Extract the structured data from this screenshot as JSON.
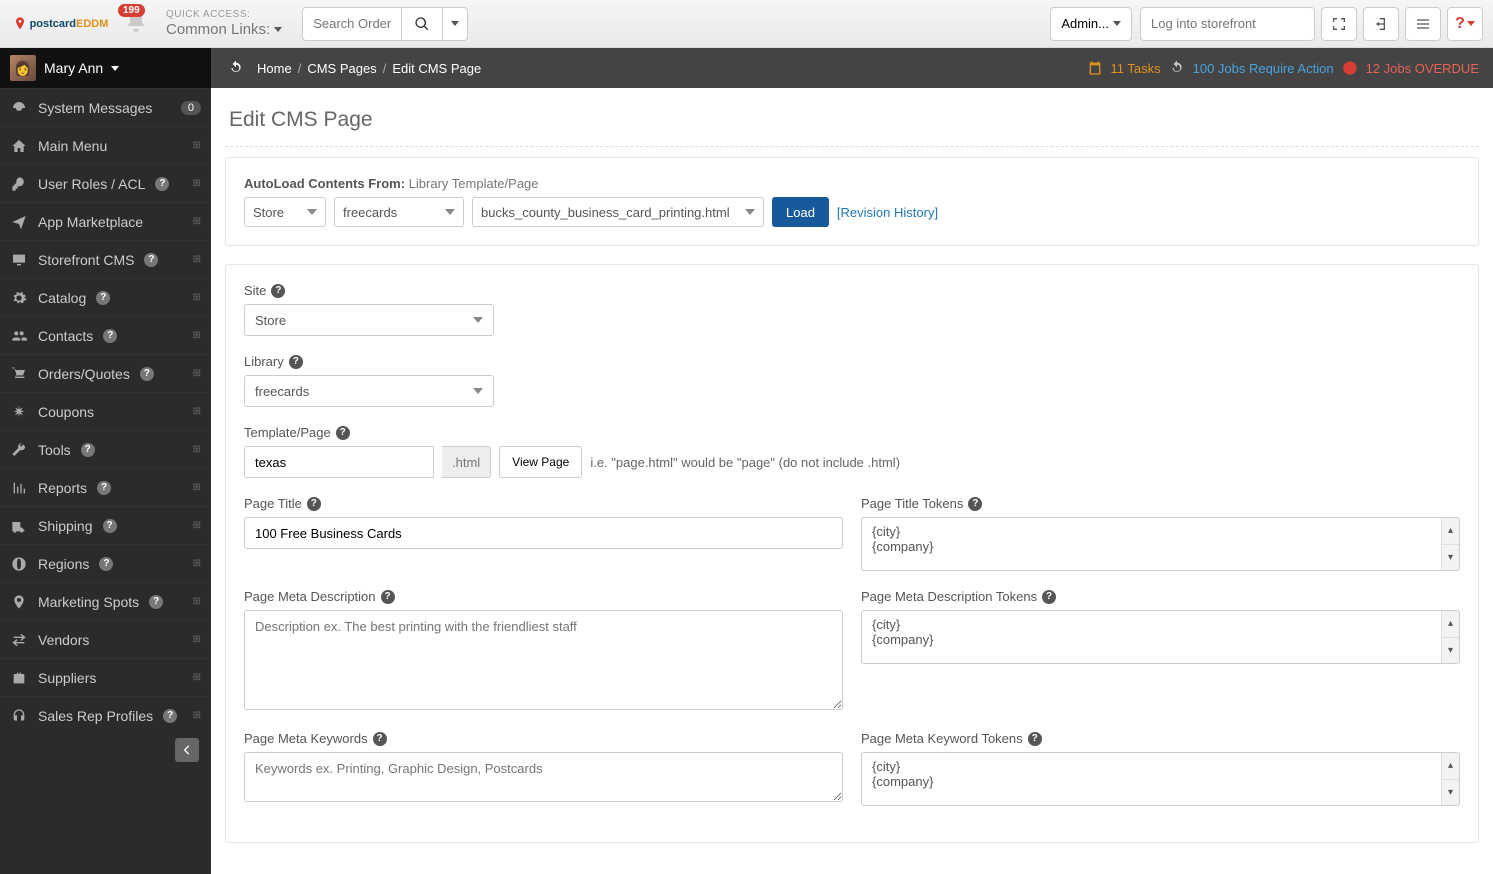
{
  "topbar": {
    "logo_pc": "postcard",
    "logo_eddm": "EDDM",
    "notif_count": "199",
    "quick_access_label": "QUICK ACCESS:",
    "quick_access_value": "Common Links:",
    "search_placeholder": "Search Orders/J",
    "admin_label": "Admin...",
    "storefront_placeholder": "Log into storefront"
  },
  "user": {
    "name": "Mary Ann"
  },
  "sidebar": {
    "items": [
      {
        "label": "System Messages",
        "badge": "0",
        "icon": "tachometer"
      },
      {
        "label": "Main Menu",
        "icon": "home",
        "expand": true
      },
      {
        "label": "User Roles / ACL",
        "icon": "key",
        "help": true,
        "expand": true
      },
      {
        "label": "App Marketplace",
        "icon": "plane",
        "expand": true
      },
      {
        "label": "Storefront CMS",
        "icon": "monitor",
        "help": true,
        "expand": true
      },
      {
        "label": "Catalog",
        "icon": "gears",
        "help": true,
        "expand": true
      },
      {
        "label": "Contacts",
        "icon": "users",
        "help": true,
        "expand": true
      },
      {
        "label": "Orders/Quotes",
        "icon": "cart",
        "help": true,
        "expand": true
      },
      {
        "label": "Coupons",
        "icon": "asterisk",
        "expand": true
      },
      {
        "label": "Tools",
        "icon": "wrench",
        "help": true,
        "expand": true
      },
      {
        "label": "Reports",
        "icon": "chart",
        "help": true,
        "expand": true
      },
      {
        "label": "Shipping",
        "icon": "truck",
        "help": true,
        "expand": true
      },
      {
        "label": "Regions",
        "icon": "globe",
        "help": true,
        "expand": true
      },
      {
        "label": "Marketing Spots",
        "icon": "pin",
        "help": true,
        "expand": true
      },
      {
        "label": "Vendors",
        "icon": "exchange",
        "expand": true
      },
      {
        "label": "Suppliers",
        "icon": "briefcase",
        "expand": true
      },
      {
        "label": "Sales Rep Profiles",
        "icon": "headphones",
        "help": true,
        "expand": true
      }
    ]
  },
  "breadcrumb": {
    "home": "Home",
    "cms": "CMS Pages",
    "current": "Edit CMS Page",
    "tasks": "11 Tasks",
    "jobs_attn": "100 Jobs Require Action",
    "jobs_overdue": "12 Jobs OVERDUE"
  },
  "page": {
    "title": "Edit CMS Page"
  },
  "autoload": {
    "label_bold": "AutoLoad Contents From:",
    "label_thin": "Library Template/Page",
    "store": "Store",
    "library": "freecards",
    "template": "bucks_county_business_card_printing.html",
    "load": "Load",
    "revision": "[Revision History]"
  },
  "form": {
    "site_label": "Site",
    "site_value": "Store",
    "library_label": "Library",
    "library_value": "freecards",
    "template_label": "Template/Page",
    "template_value": "texas",
    "template_addon": ".html",
    "view_page": "View Page",
    "template_hint": "i.e. \"page.html\" would be \"page\" (do not include .html)",
    "page_title_label": "Page Title",
    "page_title_value": "100 Free Business Cards",
    "page_title_tokens_label": "Page Title Tokens",
    "tokens": {
      "city": "{city}",
      "company": "{company}"
    },
    "meta_desc_label": "Page Meta Description",
    "meta_desc_placeholder": "Description ex. The best printing with the friendliest staff",
    "meta_desc_tokens_label": "Page Meta Description Tokens",
    "meta_kw_label": "Page Meta Keywords",
    "meta_kw_placeholder": "Keywords ex. Printing, Graphic Design, Postcards",
    "meta_kw_tokens_label": "Page Meta Keyword Tokens"
  }
}
